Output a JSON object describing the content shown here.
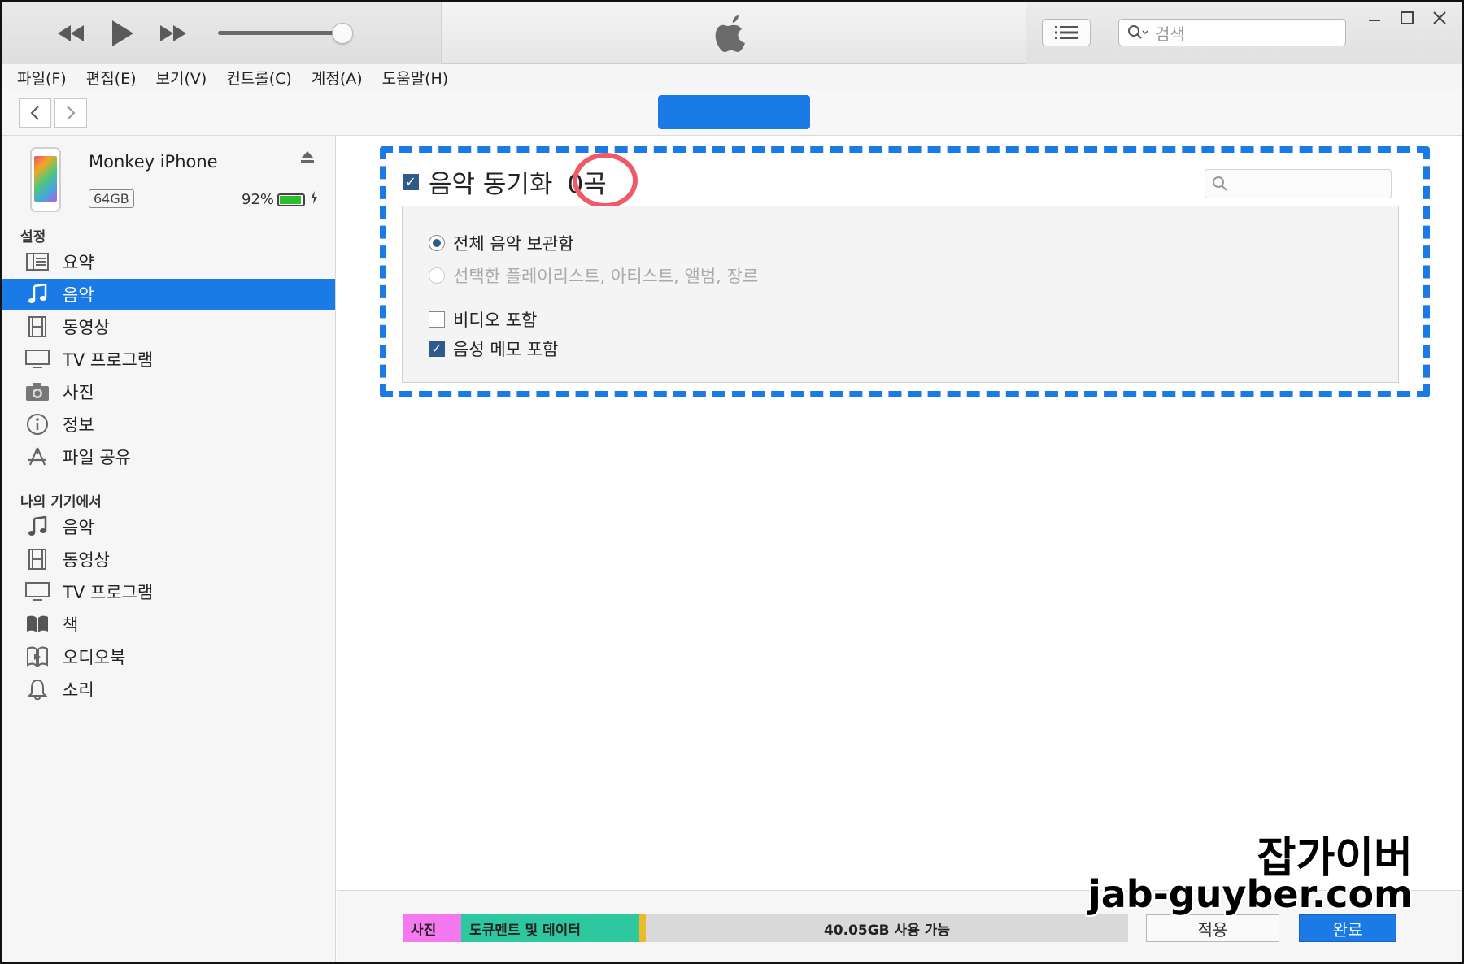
{
  "toolbar": {
    "search_placeholder": "검색"
  },
  "menu": [
    "파일(F)",
    "편집(E)",
    "보기(V)",
    "컨트롤(C)",
    "계정(A)",
    "도움말(H)"
  ],
  "device": {
    "name": "Monkey iPhone",
    "capacity": "64GB",
    "battery": "92%"
  },
  "sidebar": {
    "settings_header": "설정",
    "settings": [
      {
        "label": "요약",
        "icon": "summary-icon"
      },
      {
        "label": "음악",
        "icon": "music-note-icon"
      },
      {
        "label": "동영상",
        "icon": "film-icon"
      },
      {
        "label": "TV 프로그램",
        "icon": "tv-icon"
      },
      {
        "label": "사진",
        "icon": "camera-icon"
      },
      {
        "label": "정보",
        "icon": "info-icon"
      },
      {
        "label": "파일 공유",
        "icon": "app-store-icon"
      }
    ],
    "device_header": "나의 기기에서",
    "on_device": [
      {
        "label": "음악",
        "icon": "music-note-icon"
      },
      {
        "label": "동영상",
        "icon": "film-icon"
      },
      {
        "label": "TV 프로그램",
        "icon": "tv-icon"
      },
      {
        "label": "책",
        "icon": "book-icon"
      },
      {
        "label": "오디오북",
        "icon": "audiobook-icon"
      },
      {
        "label": "소리",
        "icon": "bell-icon"
      }
    ]
  },
  "content": {
    "sync_label": "음악 동기화",
    "sync_count": "0곡",
    "option_all": "전체 음악 보관함",
    "option_selected": "선택한 플레이리스트, 아티스트, 앨범, 장르",
    "include_video": "비디오 포함",
    "include_voice_memo": "음성 메모 포함"
  },
  "storage": {
    "photos": "사진",
    "documents": "도큐멘트 및 데이터",
    "free": "40.05GB 사용 가능"
  },
  "buttons": {
    "apply": "적용",
    "done": "완료"
  },
  "watermark": {
    "line1": "잡가이버",
    "line2": "jab-guyber.com"
  }
}
